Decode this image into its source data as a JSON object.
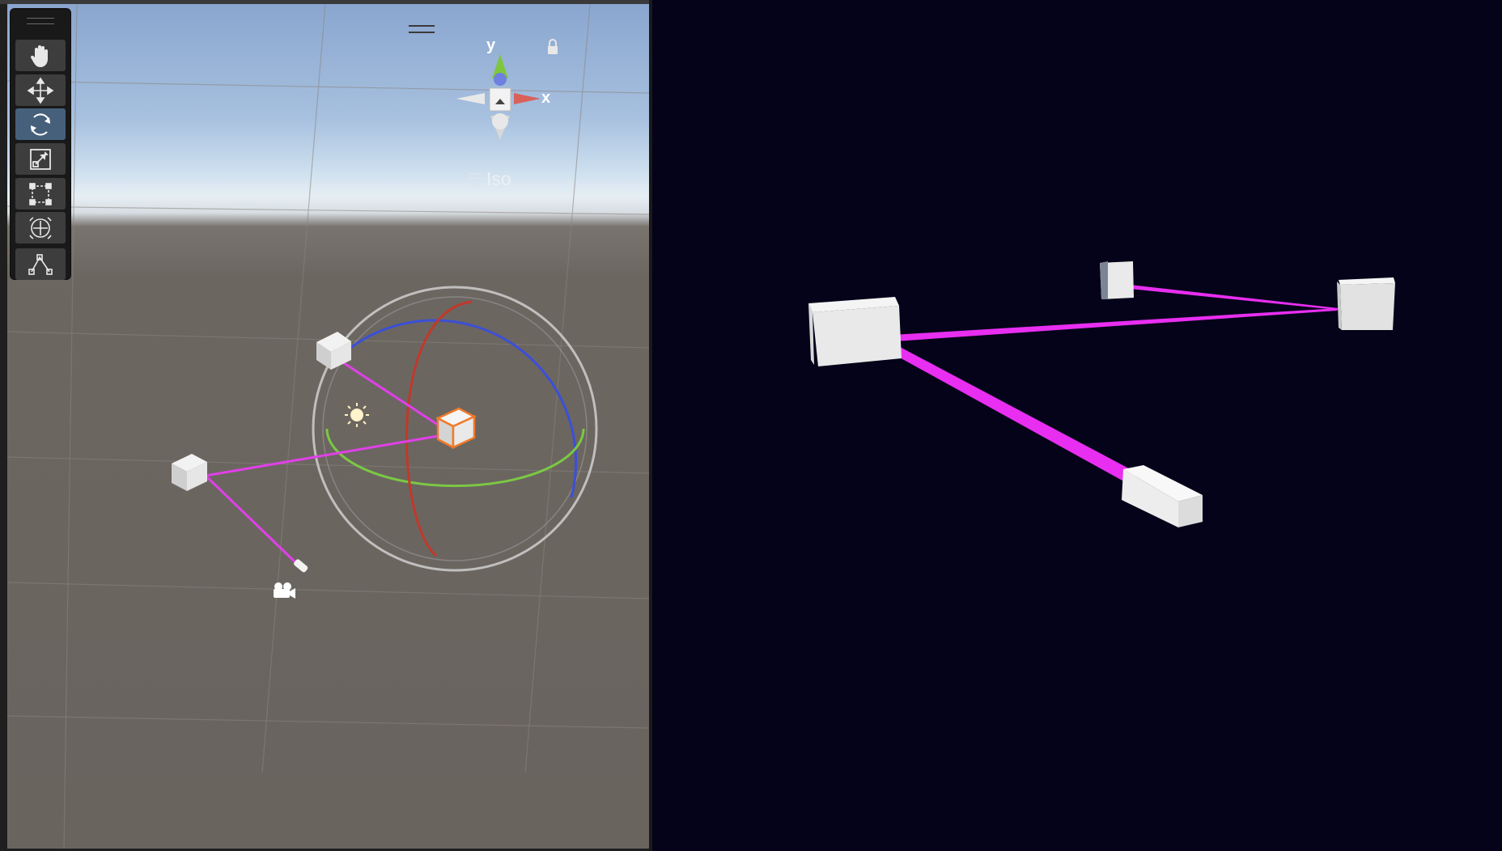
{
  "scene_view": {
    "projection_label": "Iso",
    "gizmo": {
      "axis_y": "y",
      "axis_x": "x",
      "lock_icon": "lock-icon"
    },
    "tools": [
      {
        "name": "hand-tool",
        "icon": "hand-icon",
        "active": false
      },
      {
        "name": "move-tool",
        "icon": "move-arrows-icon",
        "active": false
      },
      {
        "name": "rotate-tool",
        "icon": "rotate-icon",
        "active": true
      },
      {
        "name": "scale-tool",
        "icon": "scale-icon",
        "active": false
      },
      {
        "name": "rect-tool",
        "icon": "rect-transform-icon",
        "active": false
      },
      {
        "name": "transform-tool",
        "icon": "transform-icon",
        "active": false
      },
      {
        "name": "custom-tool",
        "icon": "path-editor-icon",
        "active": false
      }
    ],
    "colors": {
      "connection_line": "#e040e8",
      "selection_outline": "#f07a2a",
      "rotate_x_ring": "#c0392b",
      "rotate_y_ring": "#7ac943",
      "rotate_z_ring": "#3b4fd8",
      "outer_ring": "#cfcfcf"
    }
  },
  "game_view": {
    "background": "#04031a",
    "line_color": "#e82ef0"
  }
}
